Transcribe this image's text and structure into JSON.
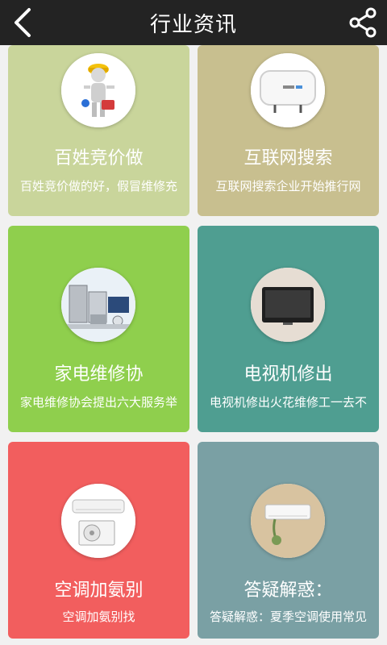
{
  "header": {
    "title": "行业资讯",
    "back_icon": "chevron-left-icon",
    "share_icon": "share-icon"
  },
  "cards": [
    {
      "title": "百姓竞价做",
      "subtitle": "百姓竞价做的好，假冒维修充",
      "color": "#c9d59b",
      "image": "repairman-illustration"
    },
    {
      "title": "互联网搜索",
      "subtitle": "互联网搜索企业开始推行网",
      "color": "#c8bf8f",
      "image": "water-heater"
    },
    {
      "title": "家电维修协",
      "subtitle": "家电维修协会提出六大服务举",
      "color": "#8fcf4d",
      "image": "home-appliances"
    },
    {
      "title": "电视机修出",
      "subtitle": "电视机修出火花维修工一去不",
      "color": "#4f9e91",
      "image": "tv"
    },
    {
      "title": "空调加氨别",
      "subtitle": "空调加氨别找",
      "color": "#f25e5e",
      "image": "air-conditioner"
    },
    {
      "title": "答疑解惑：",
      "subtitle": "答疑解惑：夏季空调使用常见",
      "color": "#7aa0a4",
      "image": "wall-ac"
    }
  ]
}
